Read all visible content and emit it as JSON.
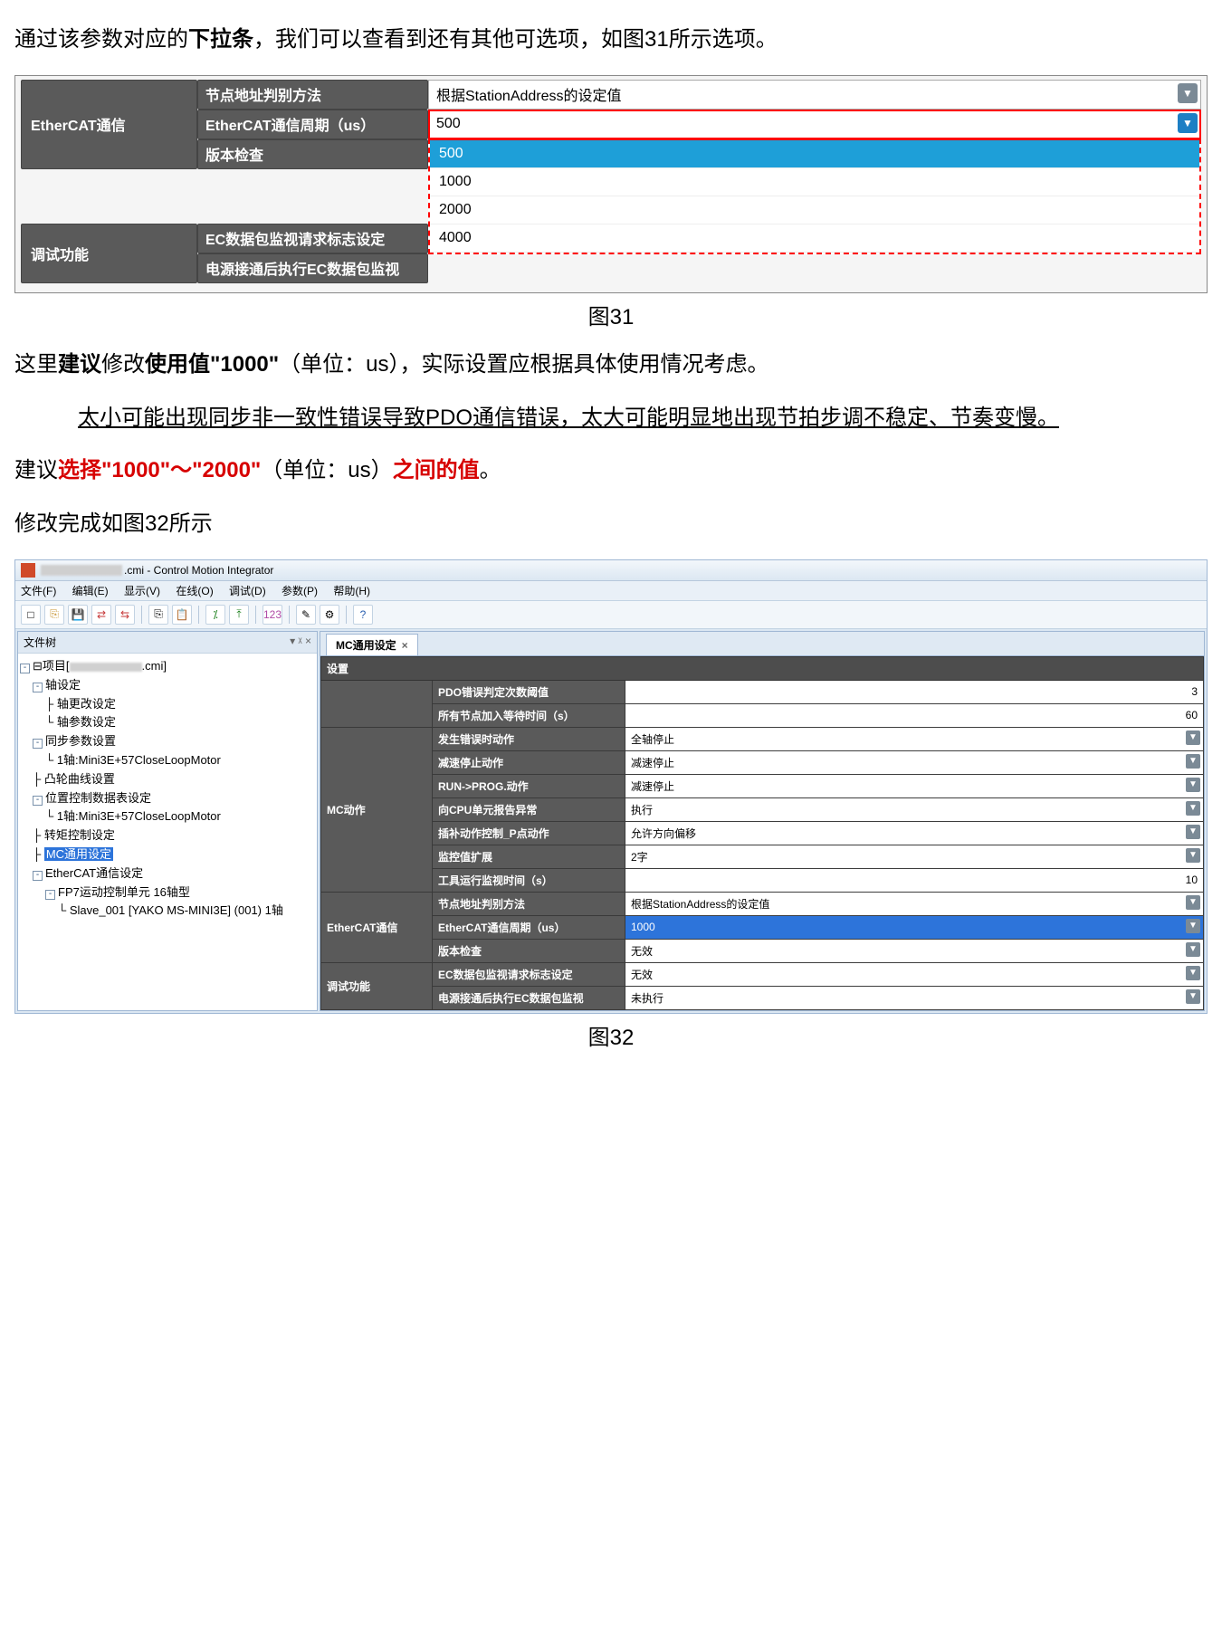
{
  "para1": {
    "a": "通过该参数对应的",
    "b": "下拉条",
    "c": "，我们可以查看到还有其他可选项，如图31所示选项。"
  },
  "fig31": {
    "cat1": "EtherCAT通信",
    "l1": "节点地址判别方法",
    "v1": "根据StationAddress的设定值",
    "l2": "EtherCAT通信周期（us）",
    "v2": "500",
    "l3": "版本检查",
    "cat2": "调试功能",
    "l4": "EC数据包监视请求标志设定",
    "l5": "电源接通后执行EC数据包监视",
    "opts": [
      "500",
      "1000",
      "2000",
      "4000"
    ]
  },
  "cap31": "图31",
  "para2": {
    "a": "这里",
    "b": "建议",
    "c": "修改",
    "d": "使用值\"1000\"",
    "e": "（单位：us），实际设置应根据具体使用情况考虑。"
  },
  "para3": "太小可能出现同步非一致性错误导致PDO通信错误，太大可能明显地出现节拍步调不稳定、节奏变慢。",
  "para4": {
    "a": "建议",
    "b": "选择\"1000\"～\"2000\"",
    "c": "（单位：us）",
    "d": "之间的值",
    "e": "。"
  },
  "para5": "修改完成如图32所示",
  "fig32": {
    "title_suffix": ".cmi - Control Motion Integrator",
    "menus": [
      "文件(F)",
      "编辑(E)",
      "显示(V)",
      "在线(O)",
      "调试(D)",
      "参数(P)",
      "帮助(H)"
    ],
    "treepane_title": "文件树",
    "tree": {
      "root": "项目[",
      "root_suffix": ".cmi]",
      "n1": "轴设定",
      "n1a": "轴更改设定",
      "n1b": "轴参数设定",
      "n2": "同步参数设置",
      "n2a": "1轴:Mini3E+57CloseLoopMotor",
      "n3": "凸轮曲线设置",
      "n4": "位置控制数据表设定",
      "n4a": "1轴:Mini3E+57CloseLoopMotor",
      "n5": "转矩控制设定",
      "n6": "MC通用设定",
      "n7": "EtherCAT通信设定",
      "n7a": "FP7运动控制单元 16轴型",
      "n7b": "Slave_001 [YAKO MS-MINI3E] (001) 1轴"
    },
    "tab": "MC通用设定",
    "grid_header": "设置",
    "rows": [
      {
        "cat": "",
        "lab": "PDO错误判定次数阈值",
        "val": "3",
        "type": "num"
      },
      {
        "cat": "",
        "lab": "所有节点加入等待时间（s）",
        "val": "60",
        "type": "num"
      },
      {
        "cat": "",
        "lab": "发生错误时动作",
        "val": "全轴停止",
        "type": "dd"
      },
      {
        "cat": "",
        "lab": "减速停止动作",
        "val": "减速停止",
        "type": "dd"
      },
      {
        "cat": "MC动作",
        "lab": "RUN->PROG.动作",
        "val": "减速停止",
        "type": "dd"
      },
      {
        "cat": "",
        "lab": "向CPU单元报告异常",
        "val": "执行",
        "type": "dd"
      },
      {
        "cat": "",
        "lab": "插补动作控制_P点动作",
        "val": "允许方向偏移",
        "type": "dd"
      },
      {
        "cat": "",
        "lab": "监控值扩展",
        "val": "2字",
        "type": "dd"
      },
      {
        "cat": "",
        "lab": "工具运行监视时间（s）",
        "val": "10",
        "type": "num"
      },
      {
        "cat": "",
        "lab": "节点地址判别方法",
        "val": "根据StationAddress的设定值",
        "type": "dd"
      },
      {
        "cat": "EtherCAT通信",
        "lab": "EtherCAT通信周期（us）",
        "val": "1000",
        "type": "dd",
        "hl": true
      },
      {
        "cat": "",
        "lab": "版本检查",
        "val": "无效",
        "type": "dd"
      },
      {
        "cat": "调试功能",
        "lab": "EC数据包监视请求标志设定",
        "val": "无效",
        "type": "dd"
      },
      {
        "cat": "",
        "lab": "电源接通后执行EC数据包监视",
        "val": "未执行",
        "type": "dd"
      }
    ]
  },
  "cap32": "图32"
}
